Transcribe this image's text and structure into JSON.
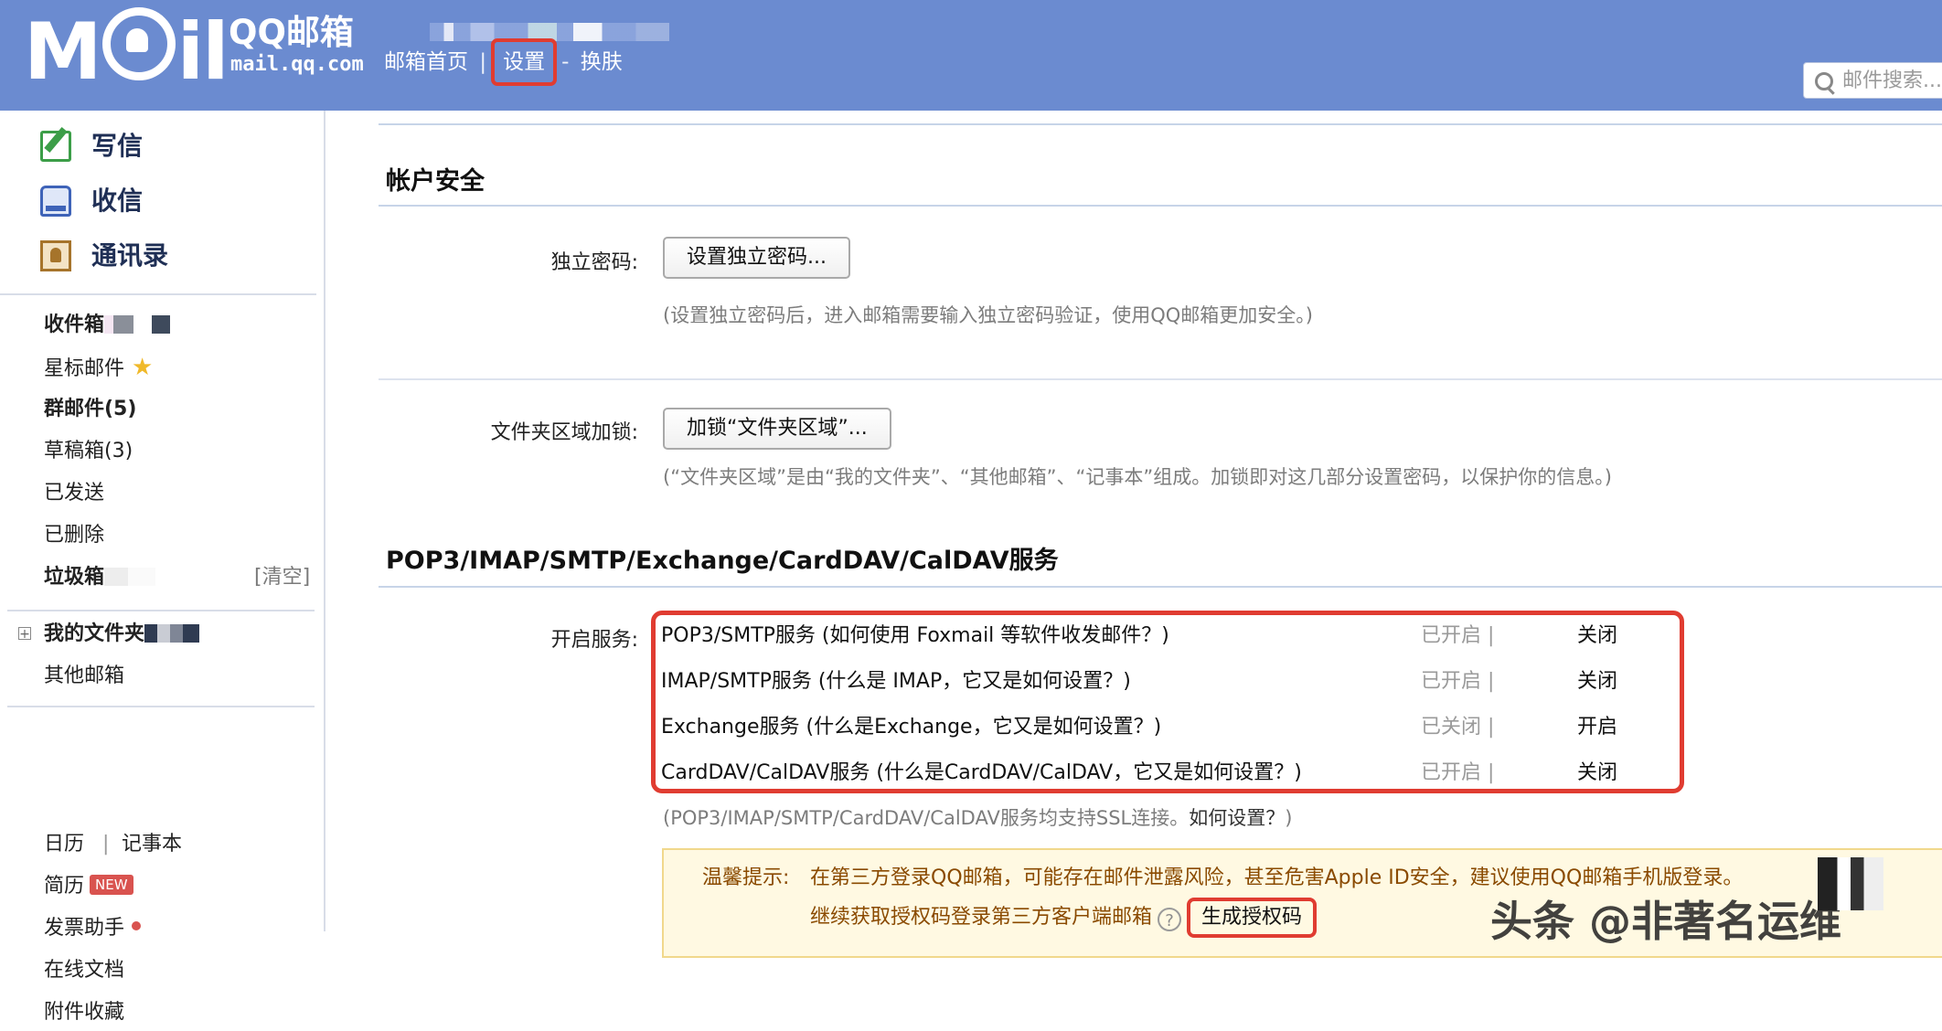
{
  "header": {
    "logo_text": "Mail",
    "brand": "QQ邮箱",
    "domain": "mail.qq.com",
    "nav": [
      {
        "label": "邮箱首页"
      },
      {
        "label": "设置"
      },
      {
        "label": "换肤"
      }
    ],
    "search_placeholder": "邮件搜索..."
  },
  "sidebar": {
    "primary": [
      {
        "label": "写信",
        "icon": "compose-icon"
      },
      {
        "label": "收信",
        "icon": "inbox-icon"
      },
      {
        "label": "通讯录",
        "icon": "contacts-icon"
      }
    ],
    "folders": [
      {
        "label": "收件箱",
        "bold": true
      },
      {
        "label": "星标邮件"
      },
      {
        "label": "群邮件(5)",
        "bold": true
      },
      {
        "label": "草稿箱(3)"
      },
      {
        "label": "已发送"
      },
      {
        "label": "已删除"
      },
      {
        "label": "垃圾箱",
        "bold": true,
        "action": "[清空]"
      }
    ],
    "my_folders": {
      "label": "我的文件夹",
      "expand": "+"
    },
    "other_mailbox": "其他邮箱",
    "tools": [
      {
        "label": "日历"
      },
      {
        "label": "记事本"
      },
      {
        "label": "简历",
        "badge": "NEW"
      },
      {
        "label": "发票助手"
      },
      {
        "label": "在线文档"
      },
      {
        "label": "附件收藏"
      }
    ]
  },
  "main": {
    "account_security": {
      "title": "帐户安全",
      "independent_password": {
        "label": "独立密码:",
        "button": "设置独立密码...",
        "hint": "(设置独立密码后，进入邮箱需要输入独立密码验证，使用QQ邮箱更加安全。)"
      },
      "folder_lock": {
        "label": "文件夹区域加锁:",
        "button": "加锁“文件夹区域”...",
        "hint": "(“文件夹区域”是由“我的文件夹”、“其他邮箱”、“记事本”组成。加锁即对这几部分设置密码，以保护你的信息。)"
      }
    },
    "protocols": {
      "title": "POP3/IMAP/SMTP/Exchange/CardDAV/CalDAV服务",
      "label": "开启服务:",
      "services": [
        {
          "name": "POP3/SMTP服务 (如何使用 Foxmail 等软件收发邮件？)",
          "status": "已开启 |",
          "action": "关闭"
        },
        {
          "name": "IMAP/SMTP服务 (什么是 IMAP，它又是如何设置？)",
          "status": "已开启 |",
          "action": "关闭"
        },
        {
          "name": "Exchange服务 (什么是Exchange，它又是如何设置？)",
          "status": "已关闭 |",
          "action": "开启"
        },
        {
          "name": "CardDAV/CalDAV服务 (什么是CardDAV/CalDAV，它又是如何设置？)",
          "status": "已开启 |",
          "action": "关闭"
        }
      ],
      "ssl_hint": "(POP3/IMAP/SMTP/CardDAV/CalDAV服务均支持SSL连接。",
      "ssl_link": "如何设置？",
      "ssl_hint_end": ")",
      "tip": {
        "prefix": "温馨提示:",
        "line1": "在第三方登录QQ邮箱，可能存在邮件泄露风险，甚至危害Apple ID安全，建议使用QQ邮箱手机版登录。",
        "line2": "继续获取授权码登录第三方客户端邮箱",
        "help": "?",
        "generate_button": "生成授权码"
      }
    },
    "watermark": "头条 @非著名运维"
  },
  "colors": {
    "header_bg": "#6b8bd0",
    "highlight_red": "#e03c31",
    "tip_bg": "#fff9e2"
  }
}
